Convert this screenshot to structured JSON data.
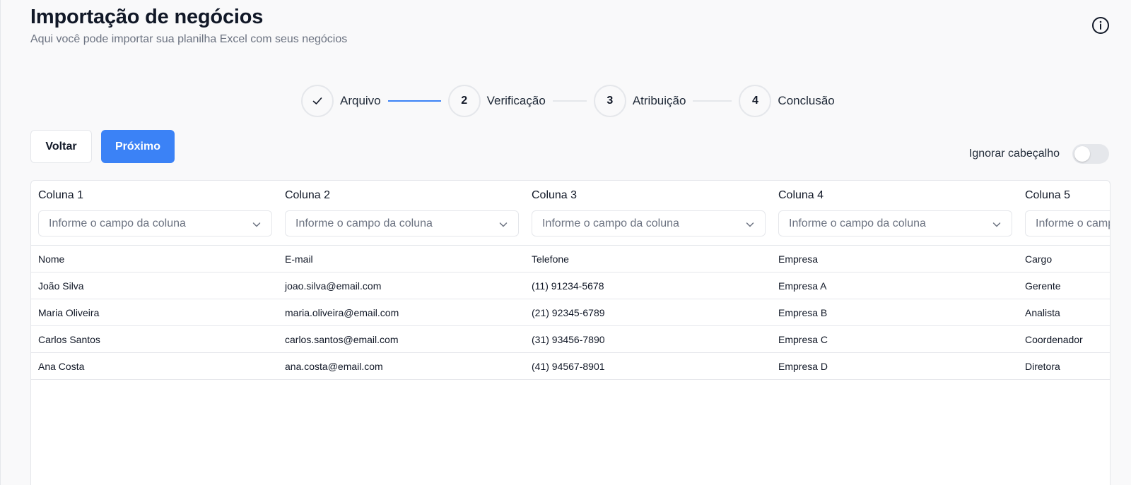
{
  "header": {
    "title": "Importação de negócios",
    "subtitle": "Aqui você pode importar sua planilha Excel com seus negócios"
  },
  "stepper": {
    "steps": [
      {
        "number": "",
        "label": "Arquivo",
        "status": "done",
        "icon": "check-icon"
      },
      {
        "number": "2",
        "label": "Verificação",
        "status": "current"
      },
      {
        "number": "3",
        "label": "Atribuição",
        "status": "pending"
      },
      {
        "number": "4",
        "label": "Conclusão",
        "status": "pending"
      }
    ]
  },
  "actions": {
    "back_label": "Voltar",
    "next_label": "Próximo"
  },
  "toggle": {
    "label": "Ignorar cabeçalho",
    "on": false
  },
  "columns": [
    {
      "title": "Coluna 1",
      "placeholder": "Informe o campo da coluna"
    },
    {
      "title": "Coluna 2",
      "placeholder": "Informe o campo da coluna"
    },
    {
      "title": "Coluna 3",
      "placeholder": "Informe o campo da coluna"
    },
    {
      "title": "Coluna 4",
      "placeholder": "Informe o campo da coluna"
    },
    {
      "title": "Coluna 5",
      "placeholder": "Informe o campo da coluna"
    }
  ],
  "rows": [
    [
      "Nome",
      "E-mail",
      "Telefone",
      "Empresa",
      "Cargo"
    ],
    [
      "João Silva",
      "joao.silva@email.com",
      "(11) 91234-5678",
      "Empresa A",
      "Gerente"
    ],
    [
      "Maria Oliveira",
      "maria.oliveira@email.com",
      "(21) 92345-6789",
      "Empresa B",
      "Analista"
    ],
    [
      "Carlos Santos",
      "carlos.santos@email.com",
      "(31) 93456-7890",
      "Empresa C",
      "Coordenador"
    ],
    [
      "Ana Costa",
      "ana.costa@email.com",
      "(41) 94567-8901",
      "Empresa D",
      "Diretora"
    ]
  ],
  "colors": {
    "accent": "#3b82f6",
    "border": "#e5e7eb",
    "muted_text": "#6b7280"
  }
}
